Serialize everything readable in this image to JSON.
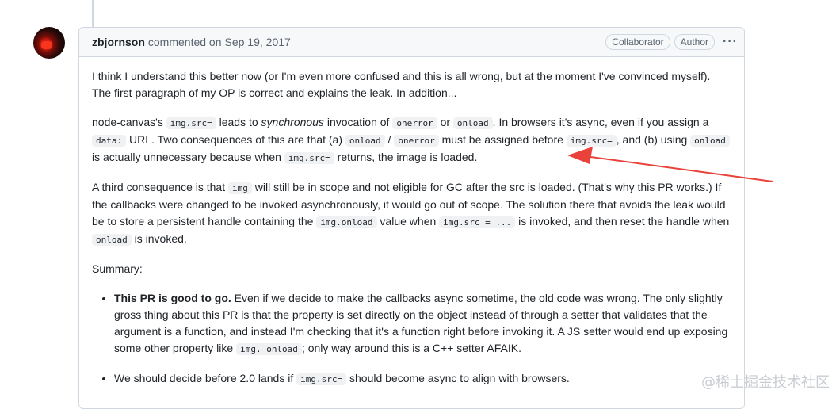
{
  "comment": {
    "author": "zbjornson",
    "header_action": "commented on",
    "date": "Sep 19, 2017",
    "badges": [
      "Collaborator",
      "Author"
    ],
    "menu_icon": "kebab-horizontal-icon"
  },
  "paragraphs": {
    "p1": "I think I understand this better now (or I'm even more confused and this is all wrong, but at the moment I've convinced myself). The first paragraph of my OP is correct and explains the leak. In addition...",
    "p2": {
      "t1": "node-canvas's ",
      "c1": "img.src=",
      "t2": " leads to ",
      "em1": "synchronous",
      "t3": " invocation of ",
      "c2": "onerror",
      "t4": " or ",
      "c3": "onload",
      "t5": ". In browsers it's async, even if you assign a ",
      "c4": "data:",
      "t6": " URL. Two consequences of this are that (a) ",
      "c5": "onload",
      "t7": " / ",
      "c6": "onerror",
      "t8": " must be assigned before ",
      "c7": "img.src=",
      "t9": ", and (b) using ",
      "c8": "onload",
      "t10": " is actually unnecessary because when ",
      "c9": "img.src=",
      "t11": " returns, the image is loaded."
    },
    "p3": {
      "t1": "A third consequence is that ",
      "c1": "img",
      "t2": " will still be in scope and not eligible for GC after the src is loaded. (That's why this PR works.) If the callbacks were changed to be invoked asynchronously, it would go out of scope. The solution there that avoids the leak would be to store a persistent handle containing the ",
      "c2": "img.onload",
      "t3": " value when ",
      "c3": "img.src = ...",
      "t4": " is invoked, and then reset the handle when ",
      "c4": "onload",
      "t5": " is invoked."
    },
    "p4": "Summary:",
    "bullet1": {
      "strong": "This PR is good to go.",
      "t1": " Even if we decide to make the callbacks async sometime, the old code was wrong. The only slightly gross thing about this PR is that the property is set directly on the object instead of through a setter that validates that the argument is a function, and instead I'm checking that it's a function right before invoking it. A JS setter would end up exposing some other property like ",
      "c1": "img._onload",
      "t2": "; only way around this is a C++ setter AFAIK."
    },
    "bullet2": {
      "t1": "We should decide before 2.0 lands if ",
      "c1": "img.src=",
      "t2": " should become async to align with browsers."
    }
  },
  "watermark": "@稀土掘金技术社区",
  "annotation": {
    "color": "#e8423a"
  }
}
